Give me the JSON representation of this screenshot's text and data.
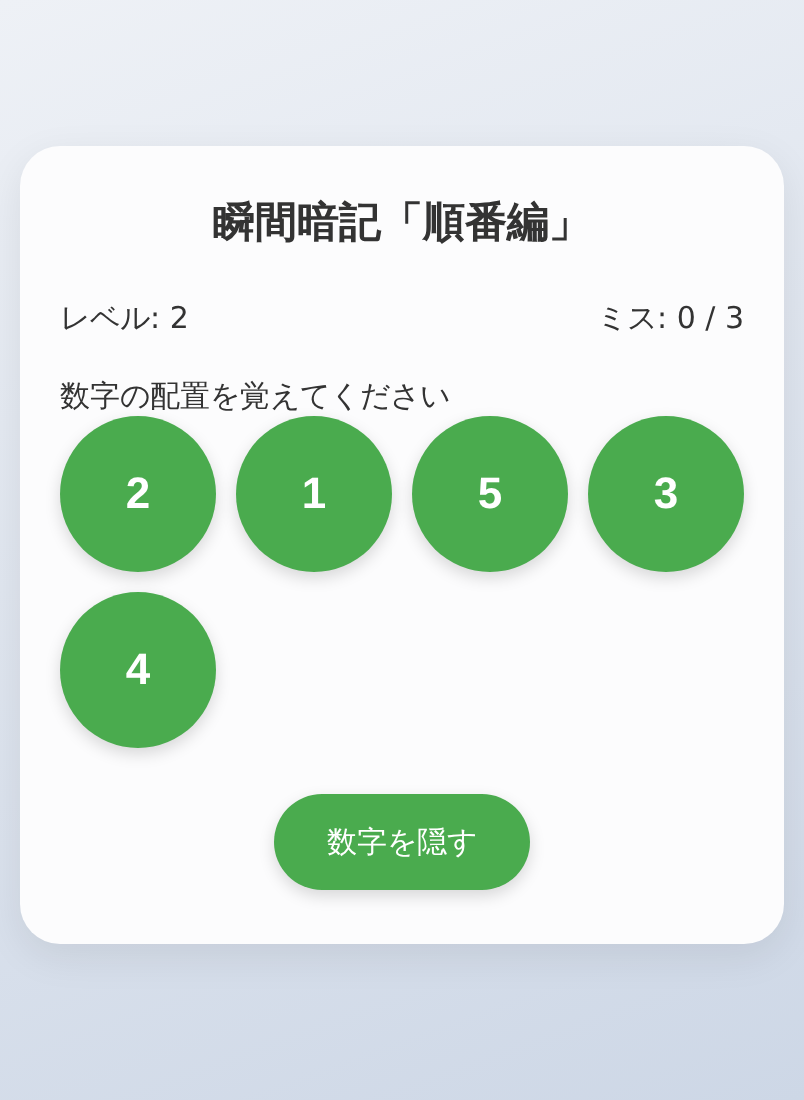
{
  "title": "瞬間暗記「順番編」",
  "status": {
    "level": "レベル: 2",
    "misses": "ミス: 0 / 3"
  },
  "instruction": "数字の配置を覚えてください",
  "tiles": [
    {
      "number": "2"
    },
    {
      "number": "1"
    },
    {
      "number": "5"
    },
    {
      "number": "3"
    },
    {
      "number": "4"
    }
  ],
  "button": "数字を隠す"
}
